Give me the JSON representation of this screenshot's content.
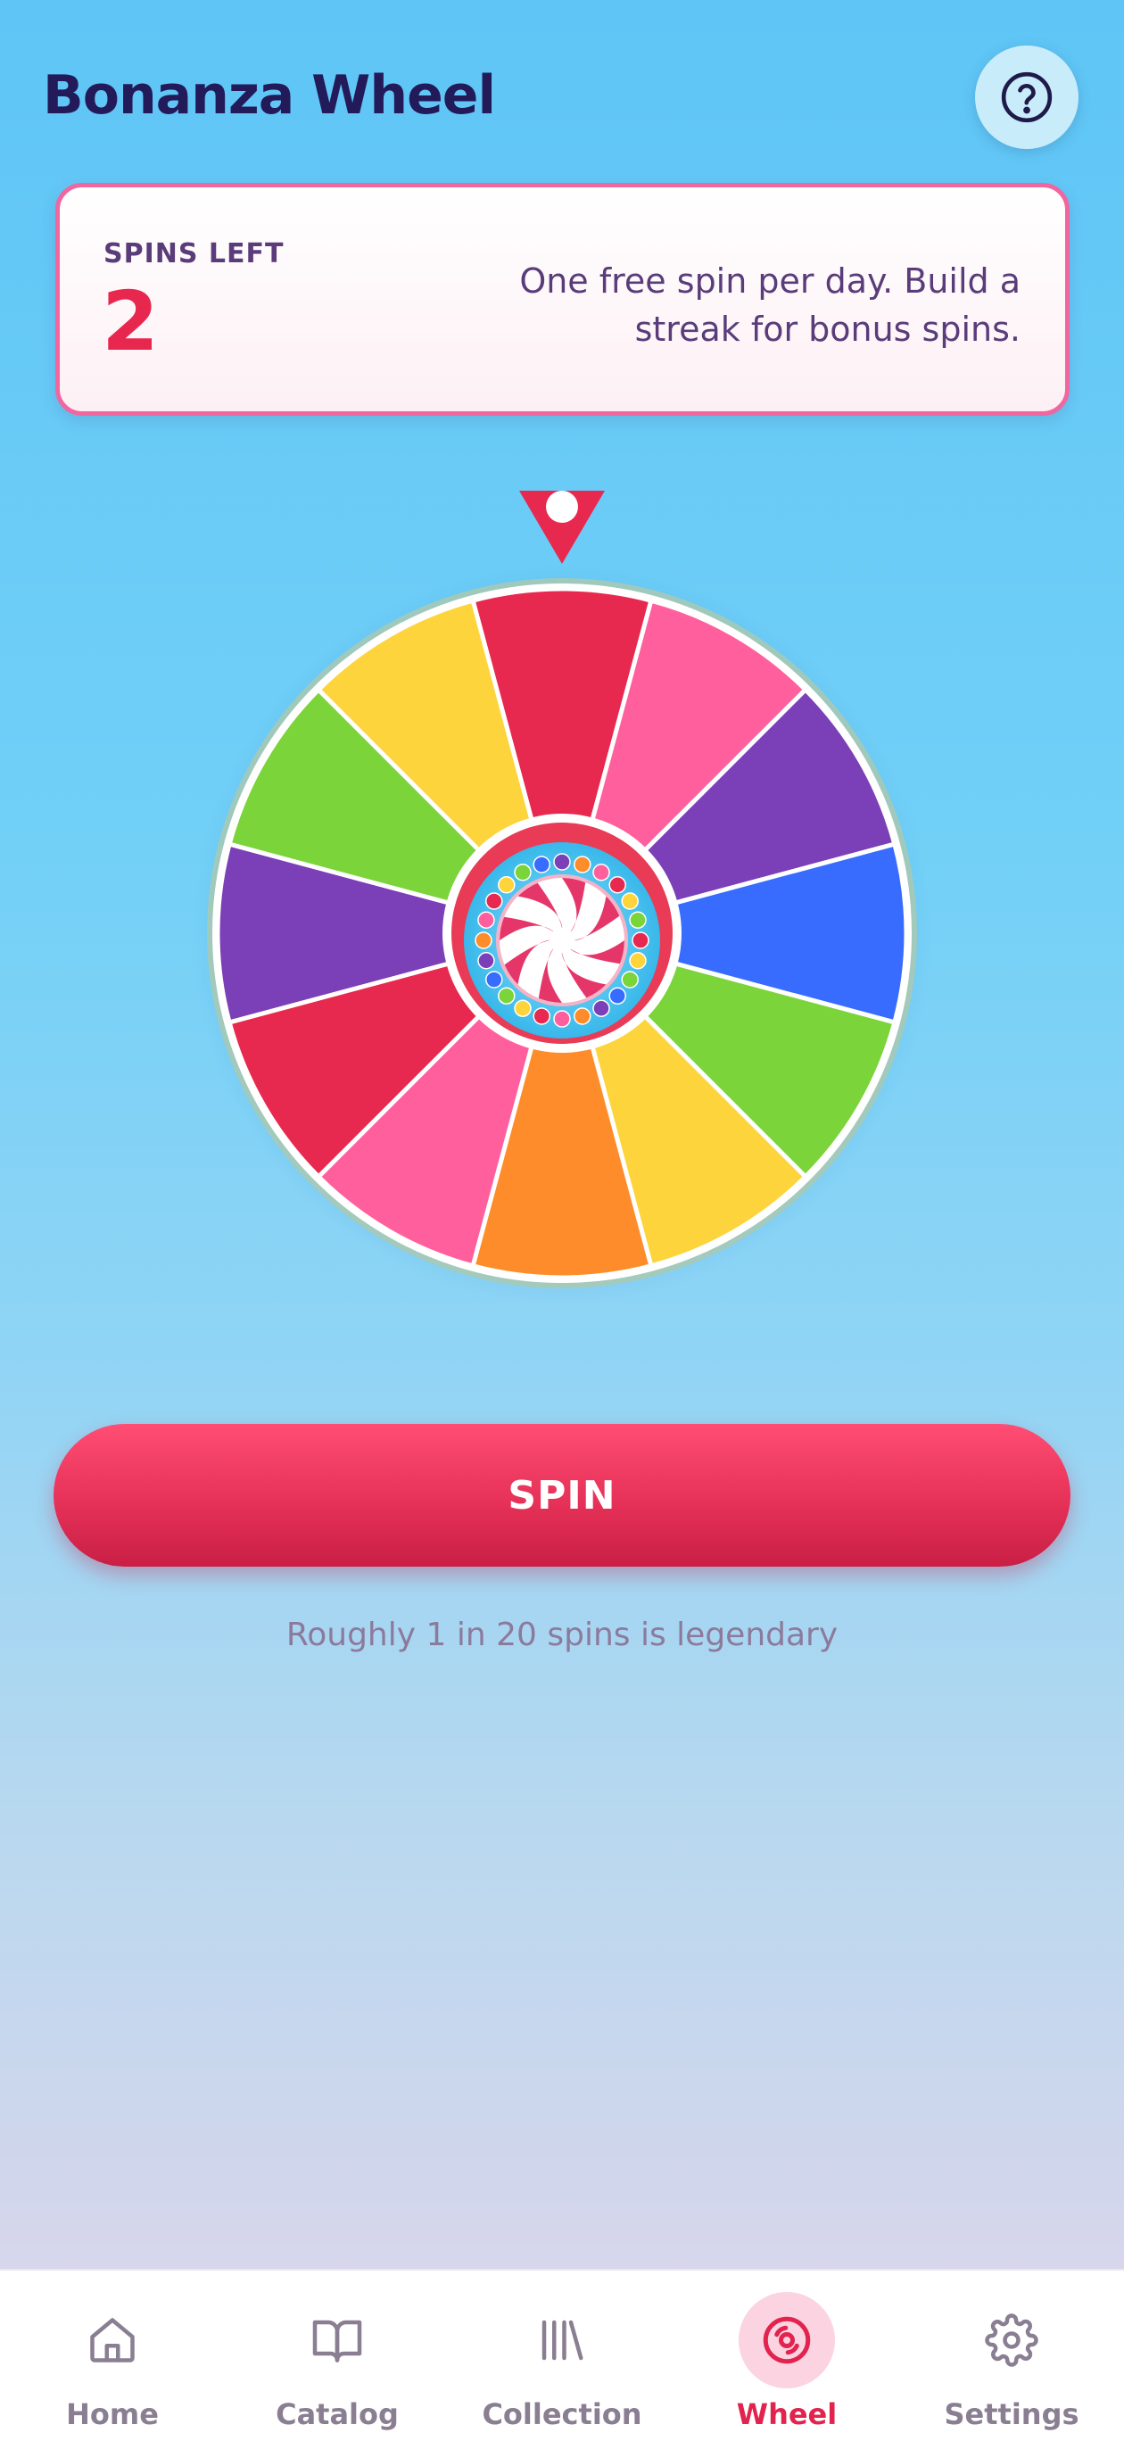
{
  "header": {
    "title": "Bonanza Wheel",
    "help_icon": "question-circle-icon"
  },
  "spins_card": {
    "label": "SPINS LEFT",
    "count": "2",
    "description": "One free spin per day. Build a streak for bonus spins."
  },
  "wheel": {
    "pointer_icon": "pointer-icon",
    "center_icon": "peppermint-candy-icon",
    "segment_colors": [
      "#e8294f",
      "#ff5f9d",
      "#7b3fb8",
      "#376cff",
      "#7ad43a",
      "#fdd43b",
      "#ff8c2b",
      "#ff5f9d",
      "#e8294f",
      "#7b3fb8",
      "#7ad43a",
      "#fdd43b"
    ]
  },
  "actions": {
    "spin_label": "SPIN",
    "odds_note": "Roughly 1 in 20 spins is legendary"
  },
  "tabbar": {
    "active": "Wheel",
    "items": [
      {
        "label": "Home",
        "icon": "home-icon"
      },
      {
        "label": "Catalog",
        "icon": "book-icon"
      },
      {
        "label": "Collection",
        "icon": "library-icon"
      },
      {
        "label": "Wheel",
        "icon": "wheel-icon"
      },
      {
        "label": "Settings",
        "icon": "gear-icon"
      }
    ]
  },
  "colors": {
    "accent": "#e8274f",
    "title": "#231a5a",
    "card_border": "#f0669f"
  }
}
